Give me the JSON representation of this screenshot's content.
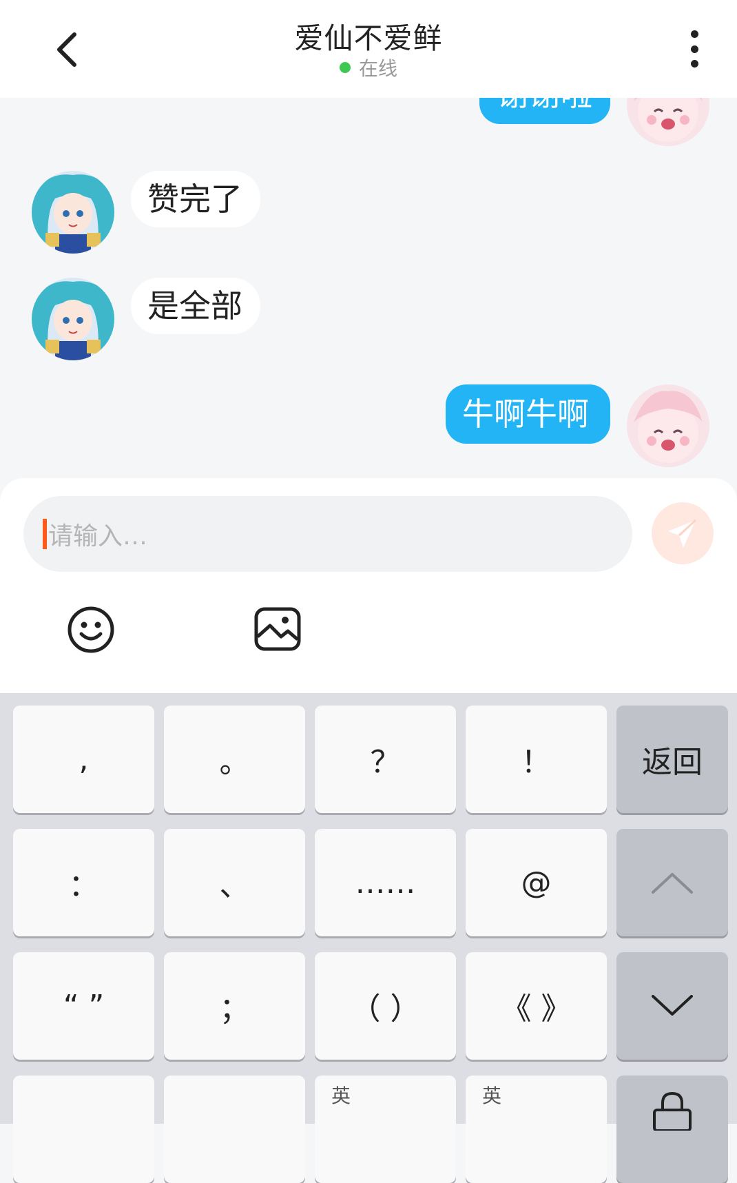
{
  "header": {
    "title": "爱仙不爱鲜",
    "status": "在线",
    "status_color": "#3cc851"
  },
  "messages": [
    {
      "side": "outgoing",
      "text": "谢谢啦",
      "partial": true
    },
    {
      "side": "incoming",
      "text": "赞完了"
    },
    {
      "side": "incoming",
      "text": "是全部"
    },
    {
      "side": "outgoing",
      "text": "牛啊牛啊"
    }
  ],
  "input": {
    "placeholder": "请输入…"
  },
  "toolbar": {
    "icons": [
      "emoji-icon",
      "image-icon"
    ]
  },
  "keyboard": {
    "rows": [
      [
        ",",
        "。",
        "？",
        "！",
        "返回"
      ],
      [
        "：",
        "、",
        "……",
        "@",
        "shift-up"
      ],
      [
        "“ ”",
        "；",
        "（ ）",
        "《 》",
        "collapse-down"
      ],
      [
        "",
        "",
        "英",
        "英",
        "lock"
      ]
    ]
  },
  "colors": {
    "accent_blue": "#22b4f5",
    "send_bg": "#ffe8e0",
    "caret": "#ff5a1a"
  }
}
